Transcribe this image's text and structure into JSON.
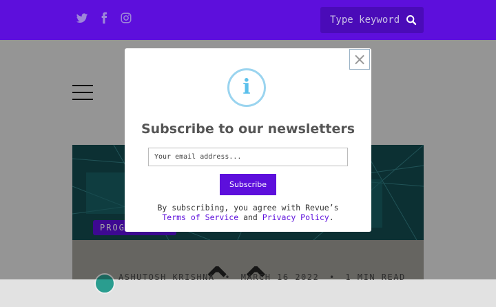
{
  "header": {
    "social": [
      "twitter-icon",
      "facebook-icon",
      "instagram-icon"
    ],
    "search_placeholder": "Type keyword",
    "brand_color": "#5d0fdc"
  },
  "post": {
    "tag": "PROGRAMMING",
    "author": "ASHUTOSH KRISHNA",
    "date": "MARCH 16 2022",
    "read_time": "1 MIN READ",
    "separator": "•"
  },
  "modal": {
    "close_label": "×",
    "info_glyph": "i",
    "title": "Subscribe to our newsletters",
    "email_placeholder": "Your email address...",
    "subscribe_label": "Subscribe",
    "terms_prefix": "By subscribing, you agree with Revue’s",
    "terms_link": "Terms of Service",
    "and_text": "and",
    "privacy_link": "Privacy Policy",
    "period": "."
  }
}
